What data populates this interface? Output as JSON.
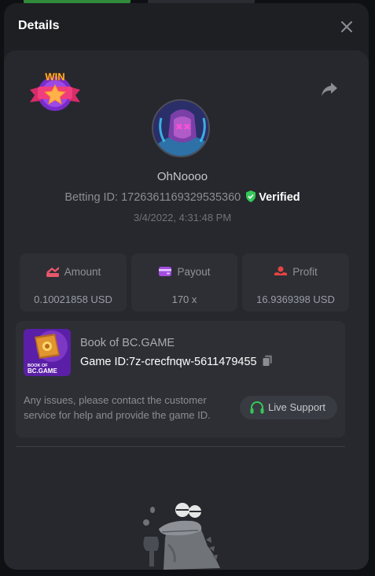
{
  "header": {
    "title": "Details"
  },
  "badge": {
    "text": "WIN"
  },
  "player": {
    "username": "OhNoooo",
    "betting_id_label": "Betting ID:",
    "betting_id": "1726361169329535360",
    "verified_label": "Verified",
    "timestamp": "3/4/2022, 4:31:48 PM"
  },
  "stats": [
    {
      "label": "Amount",
      "value": "0.10021858 USD",
      "icon": "amount-icon"
    },
    {
      "label": "Payout",
      "value": "170 x",
      "icon": "payout-icon"
    },
    {
      "label": "Profit",
      "value": "16.9369398 USD",
      "icon": "profit-icon"
    }
  ],
  "game": {
    "name": "Book of BC.GAME",
    "id_label": "Game ID:",
    "id": "7z-crecfnqw-5611479455",
    "thumb_text_top": "BOOK OF",
    "thumb_text_bottom": "BC.GAME",
    "help_text": "Any issues, please contact the customer service for help and provide the game ID.",
    "support_label": "Live Support"
  },
  "colors": {
    "accent_green": "#35c759",
    "amount": "#e8576b",
    "payout": "#a24de0",
    "profit": "#e84343"
  }
}
